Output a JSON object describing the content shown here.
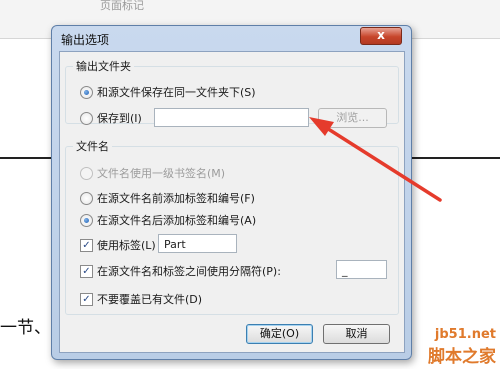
{
  "background": {
    "toolbar_label": "页面标记",
    "section_text": "一节、"
  },
  "dialog": {
    "title": "输出选项",
    "close_label": "x",
    "output_folder": {
      "legend": "输出文件夹",
      "same_folder_label": "和源文件保存在同一文件夹下(S)",
      "save_to_label": "保存到(I)",
      "path_value": "",
      "browse_label": "浏览..."
    },
    "filename": {
      "legend": "文件名",
      "opt1_label": "文件名使用一级书签名(M)",
      "opt2_label": "在源文件名前添加标签和编号(F)",
      "opt3_label": "在源文件名后添加标签和编号(A)",
      "use_tag_label": "使用标签(L)",
      "tag_value": "Part",
      "separator_label": "在源文件名和标签之间使用分隔符(P):",
      "separator_value": "_",
      "no_overwrite_label": "不要覆盖已有文件(D)"
    },
    "ok_label": "确定(O)",
    "cancel_label": "取消"
  },
  "annotation": {
    "arrow_color": "#e53b2c"
  },
  "watermark": {
    "line1": "jb51.net",
    "line2": "脚本之家"
  }
}
